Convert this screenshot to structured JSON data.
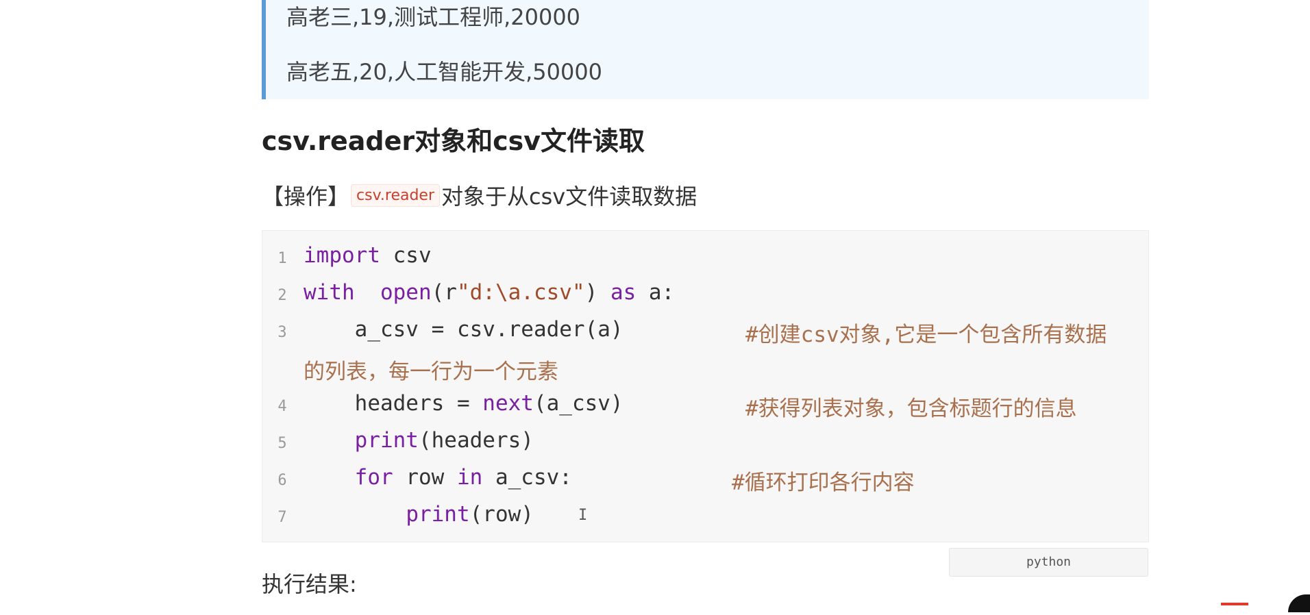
{
  "blockquote": {
    "lines": [
      "高老三,19,测试工程师,20000",
      "高老五,20,人工智能开发,50000"
    ]
  },
  "heading": "csv.reader对象和csv文件读取",
  "operation": {
    "prefix": "【操作】",
    "inline_code": "csv.reader",
    "suffix": "对象于从csv文件读取数据"
  },
  "code": {
    "language": "python",
    "line_numbers": [
      "1",
      "2",
      "3",
      "4",
      "5",
      "6",
      "7"
    ],
    "l1": {
      "kw": "import",
      "rest": " csv"
    },
    "l2": {
      "kw": "with",
      "sp": "  ",
      "fn": "open",
      "p1": "(r",
      "str": "\"d:\\a.csv\"",
      "p2": ") ",
      "as": "as",
      "rest": " a:"
    },
    "l3": {
      "code": "    a_csv = csv.reader(a)",
      "comment": "#创建csv对象,它是一个包含所有数据",
      "wrap": "的列表，每一行为一个元素"
    },
    "l4": {
      "pre": "    headers = ",
      "fn": "next",
      "rest": "(a_csv)",
      "comment": "#获得列表对象，包含标题行的信息"
    },
    "l5": {
      "pre": "    ",
      "fn": "print",
      "rest": "(headers)"
    },
    "l6": {
      "pre": "    ",
      "kw": "for",
      "mid": " row ",
      "kw2": "in",
      "rest": " a_csv:",
      "comment": "#循环打印各行内容"
    },
    "l7": {
      "pre": "        ",
      "fn": "print",
      "rest": "(row)"
    }
  },
  "result_label": "执行结果:",
  "cursor_glyph": "I"
}
